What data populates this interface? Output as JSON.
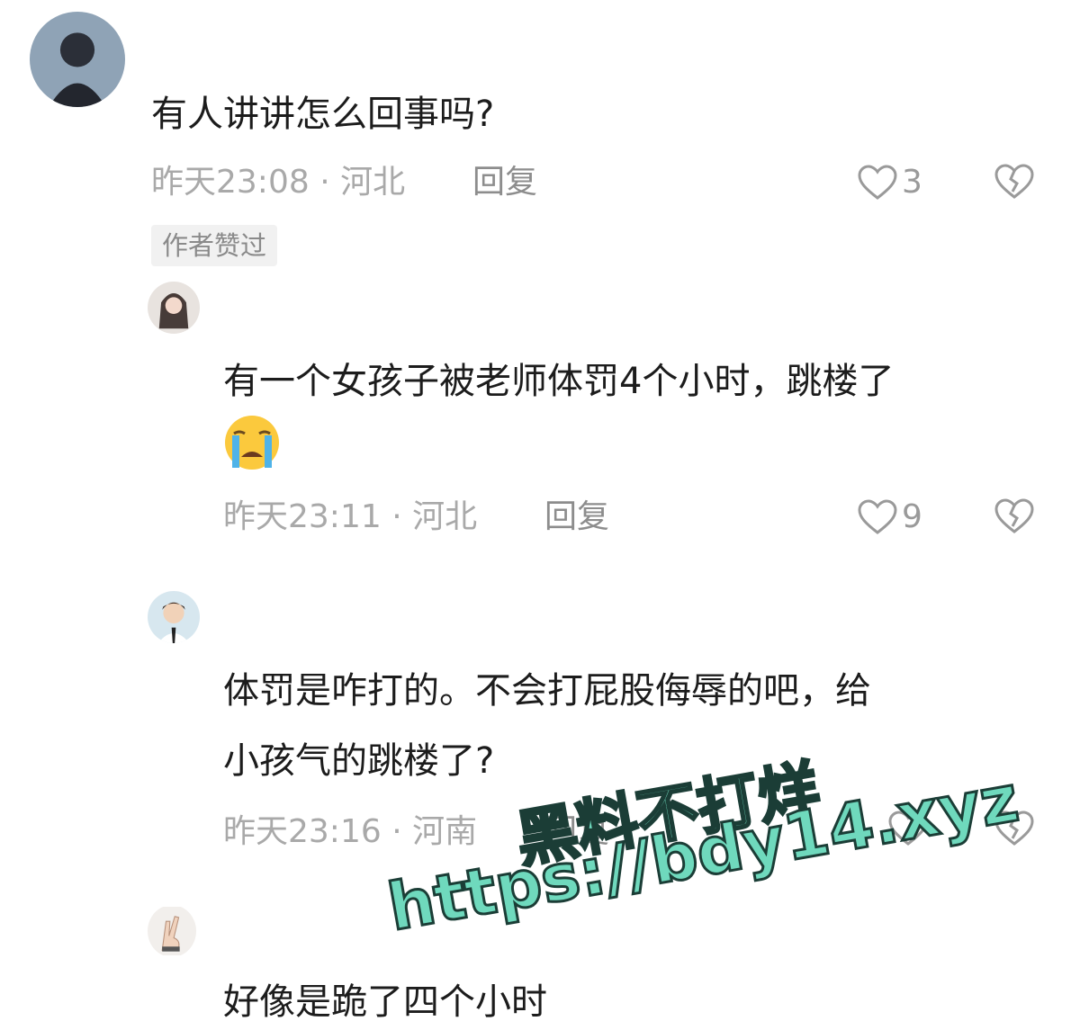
{
  "comments": [
    {
      "text": "有人讲讲怎么回事吗?",
      "time_location": "昨天23:08 · 河北",
      "reply_label": "回复",
      "like_count": "3",
      "badge": "作者赞过"
    },
    {
      "text_line1": "有一个女孩子被老师体罚4个小时，跳楼了",
      "emoji": "loudly-crying-face",
      "time_location": "昨天23:11 · 河北",
      "reply_label": "回复",
      "like_count": "9"
    },
    {
      "text_line1": "体罚是咋打的。不会打屁股侮辱的吧，给",
      "text_line2": "小孩气的跳楼了?",
      "time_location": "昨天23:16 · 河南",
      "reply_label": "回复",
      "like_count": ""
    },
    {
      "text": "好像是跪了四个小时"
    }
  ],
  "watermark": {
    "line1": "黑料不打烊",
    "line2": "https://bdy14.xyz"
  },
  "colors": {
    "text": "#1c1c1c",
    "meta": "#a9a9a9",
    "watermark_fill": "#6fd9bd",
    "watermark_stroke": "#1b3d36"
  }
}
